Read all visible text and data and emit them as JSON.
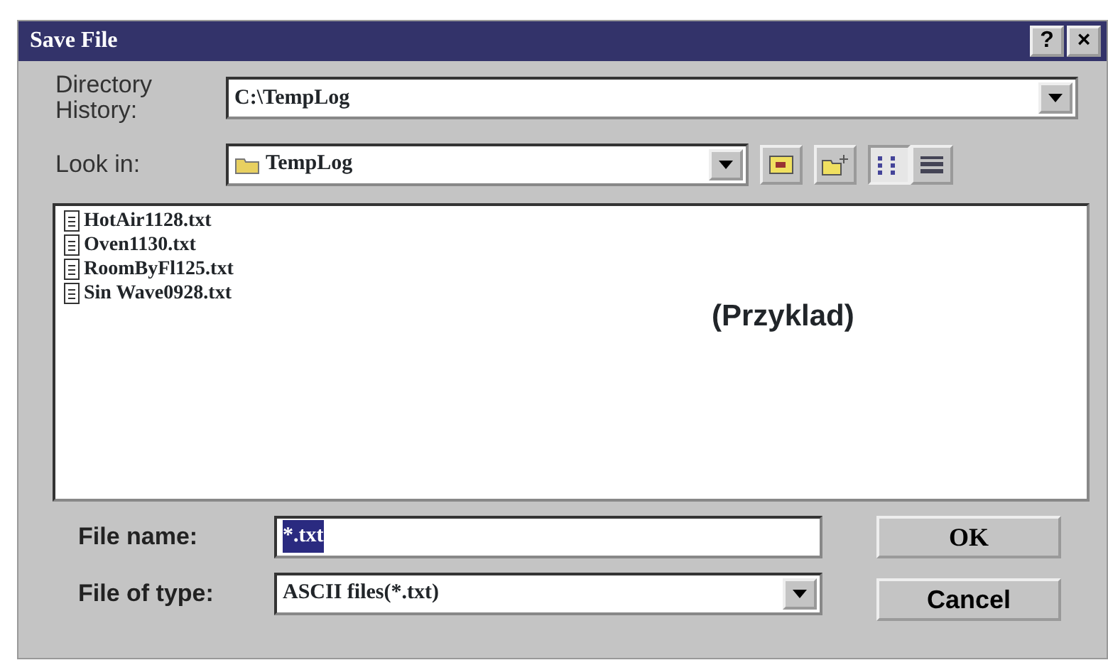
{
  "window": {
    "title": "Save File",
    "title_buttons": [
      "?",
      "×"
    ]
  },
  "directory_history": {
    "label": "Directory History:",
    "value": "C:\\TempLog"
  },
  "look_in": {
    "label": "Look in:",
    "value": "TempLog"
  },
  "files": [
    {
      "name": "HotAir1128.txt"
    },
    {
      "name": "Oven1130.txt"
    },
    {
      "name": "RoomByFl125.txt"
    },
    {
      "name": "Sin Wave0928.txt"
    }
  ],
  "list_caption": "(Przyklad)",
  "file_name": {
    "label": "File name:",
    "value": "*.txt",
    "selected": true
  },
  "file_type": {
    "label": "File of type:",
    "value": "ASCII files(*.txt)"
  },
  "buttons": [
    "OK",
    "Cancel"
  ]
}
